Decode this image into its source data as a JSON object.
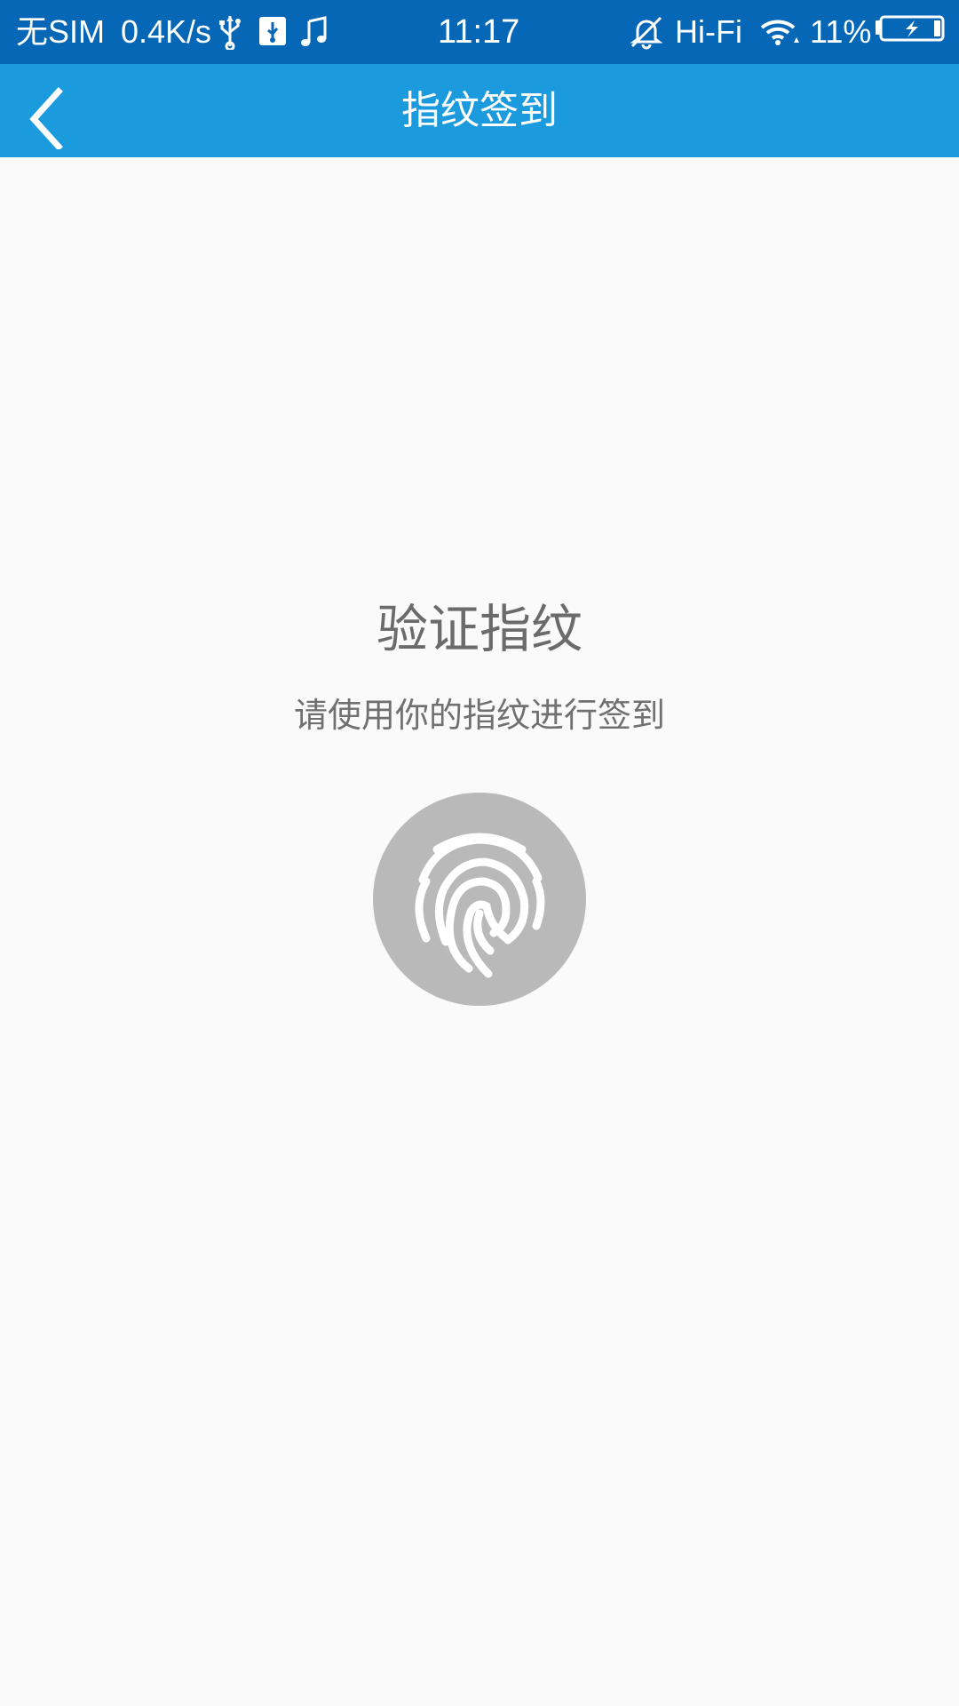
{
  "status_bar": {
    "carrier": "无SIM",
    "net_speed": "0.4K/s",
    "time": "11:17",
    "hifi": "Hi-Fi",
    "battery_percent": "11%",
    "icons": [
      "usb-icon",
      "usb-debug-icon",
      "music-note-icon",
      "bell-off-icon",
      "wifi-icon",
      "battery-charging-icon"
    ]
  },
  "toolbar": {
    "title": "指纹签到",
    "back_icon": "chevron-left-icon"
  },
  "main": {
    "heading": "验证指纹",
    "subheading": "请使用你的指纹进行签到",
    "fingerprint_icon": "fingerprint-icon"
  },
  "colors": {
    "status_bar_bg": "#0767b7",
    "toolbar_bg": "#1b9ade",
    "page_bg": "#fafafa",
    "fingerprint_circle": "#b9b9b9"
  }
}
